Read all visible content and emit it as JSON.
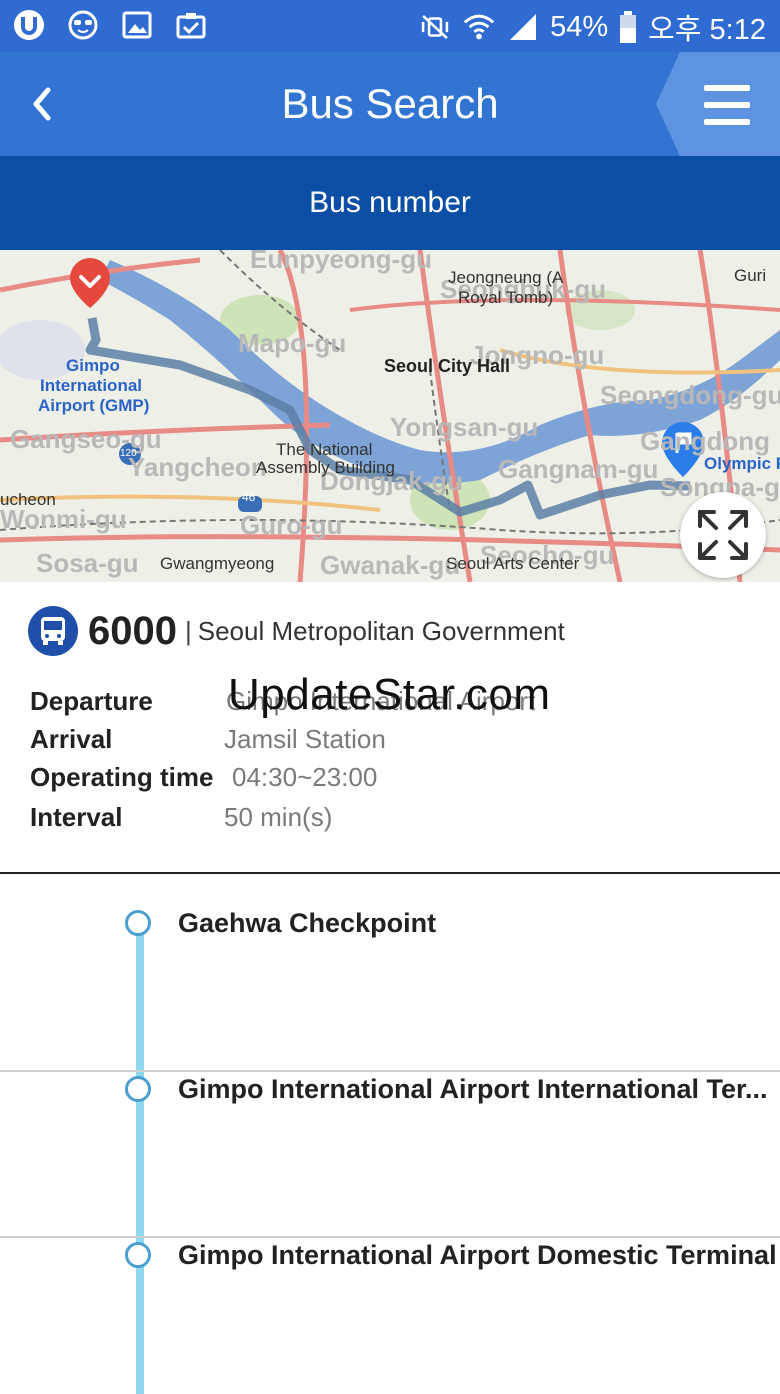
{
  "status_bar": {
    "battery": "54%",
    "time": "오후 5:12"
  },
  "header": {
    "title": "Bus Search"
  },
  "tab": {
    "label": "Bus number"
  },
  "map": {
    "labels": {
      "guri": "Guri",
      "jeongneung": "Jeongneung (A",
      "royal_tomb": "Royal Tomb)",
      "city_hall": "Seoul City Hall",
      "gimpo": "Gimpo",
      "international": "International",
      "airport_gmp": "Airport (GMP)",
      "national": "The National",
      "assembly": "Assembly Building",
      "olympic": "Olympic Pa",
      "bucheon": "ucheon",
      "gwangmyeong": "Gwangmyeong",
      "arts_center": "Seoul Arts Center",
      "mapo": "Mapo-gu",
      "yongsan": "Yongsan-gu",
      "yangcheon": "Yangcheon",
      "wonmi": "Wonmi-gu",
      "guro": "Guro-gu",
      "gangnam": "Gangnam-gu",
      "eunpyeong": "Eunpyeong-gu",
      "gwanak": "Gwanak-gu",
      "seocho": "Seocho-gu",
      "sosa": "Sosa-gu",
      "gangseo": "Gangseo-gu",
      "dongjak": "Dongjak-gu",
      "seongdong": "Seongdong-gu",
      "gangdong": "Gangdong",
      "songpa": "Songpa-gu",
      "jongno": "Jongno-gu",
      "seongbuk": "Seongbuk-gu",
      "route_46": "46",
      "route_120": "120"
    }
  },
  "bus": {
    "number": "6000",
    "separator": "|",
    "agency": "Seoul Metropolitan Government",
    "details": [
      {
        "label": "Departure",
        "value": "Gimpo International Airport"
      },
      {
        "label": "Arrival",
        "value": "Jamsil Station"
      },
      {
        "label": "Operating time",
        "value": "04:30~23:00"
      },
      {
        "label": "Interval",
        "value": "50 min(s)"
      }
    ]
  },
  "watermark": "UpdateStar.com",
  "stops": [
    {
      "name": "Gaehwa Checkpoint"
    },
    {
      "name": "Gimpo International Airport International Ter..."
    },
    {
      "name": "Gimpo International Airport Domestic Terminal"
    }
  ],
  "colors": {
    "statusbar": "#2f6bd0",
    "appbar": "#3274d2",
    "tabbar": "#0a4fa5",
    "bus_icon": "#1f4fa8",
    "route_line": "#8ed8f0",
    "stop_dot": "#4a9fd0"
  }
}
